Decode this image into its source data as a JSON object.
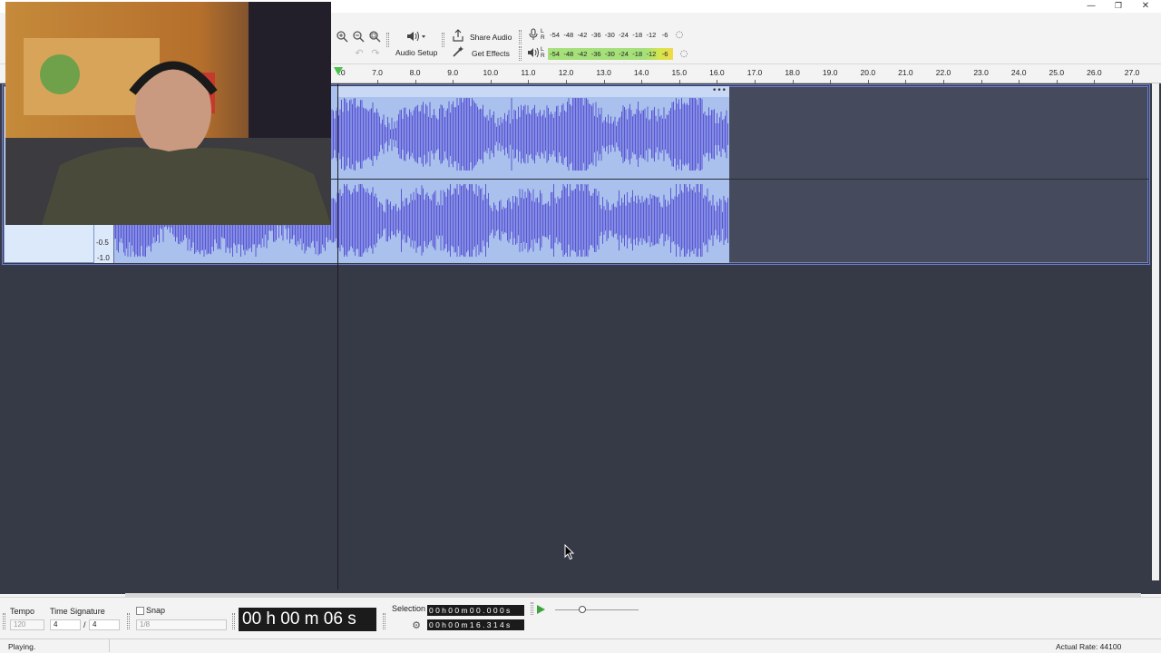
{
  "window": {
    "minimize_glyph": "—",
    "restore_glyph": "❐",
    "close_glyph": "✕"
  },
  "toolbar": {
    "audio_setup_label": "Audio Setup",
    "share_audio_label": "Share Audio",
    "get_effects_label": "Get Effects",
    "meter_scale": [
      "-54",
      "-48",
      "-42",
      "-36",
      "-30",
      "-24",
      "-18",
      "-12",
      "-6"
    ],
    "record_meter_channels": [
      "L",
      "R"
    ],
    "playback_meter_channels": [
      "L",
      "R"
    ]
  },
  "ruler": {
    "ticks": [
      "7.0",
      "8.0",
      "9.0",
      "10.0",
      "11.0",
      "12.0",
      "13.0",
      "14.0",
      "15.0",
      "16.0",
      "17.0",
      "18.0",
      "19.0",
      "20.0",
      "21.0",
      "22.0",
      "23.0",
      "24.0",
      "25.0",
      "26.0",
      "27.0"
    ],
    "start_label": ".0"
  },
  "track": {
    "scale_labels": [
      "-0.5",
      "-1.0"
    ],
    "clip_menu_glyph": "•••"
  },
  "bottom": {
    "tempo_label": "Tempo",
    "tempo_value": "120",
    "time_signature_label": "Time Signature",
    "time_sig_top": "4",
    "time_sig_slash": "/",
    "time_sig_bottom": "4",
    "snap_label": "Snap",
    "snap_value": "1/8",
    "time_display": "00 h 00 m 06 s",
    "selection_label": "Selection",
    "selection_start": "0 0 h 0 0 m 0 0 . 0 0 0 s",
    "selection_end": "0 0 h 0 0 m 1 6 . 3 1 4 s"
  },
  "status": {
    "state": "Playing.",
    "actual_rate": "Actual Rate: 44100"
  }
}
